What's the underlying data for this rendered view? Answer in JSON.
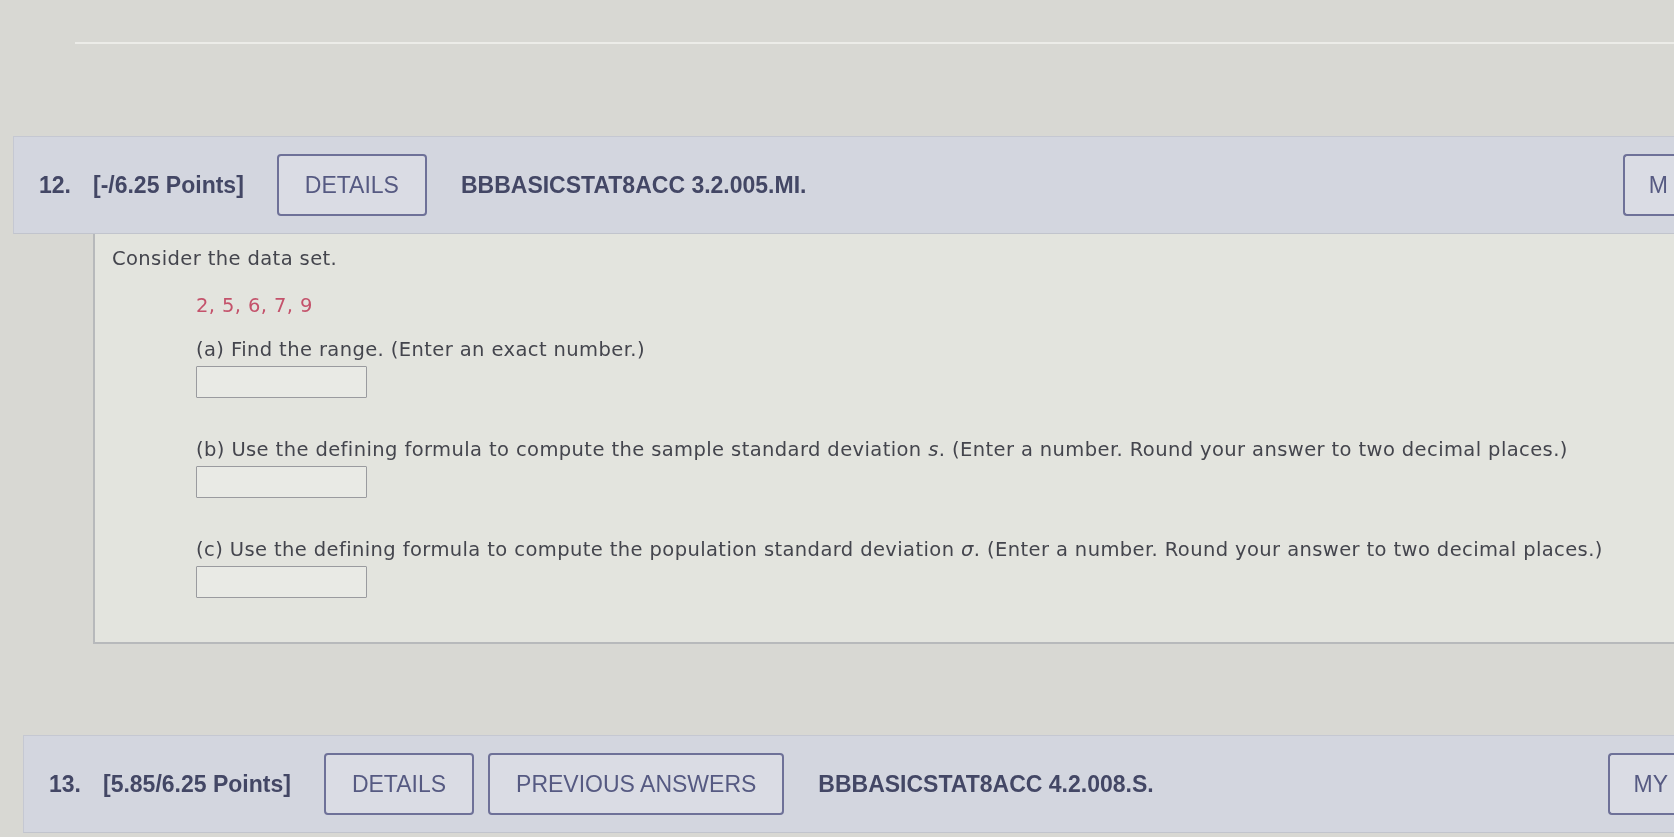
{
  "questions": [
    {
      "number": "12.",
      "points": "[-/6.25 Points]",
      "buttons": [
        {
          "label": "DETAILS"
        }
      ],
      "code": "BBBASICSTAT8ACC 3.2.005.MI.",
      "corner_button": "M",
      "body": {
        "intro": "Consider the data set.",
        "data": "2, 5, 6, 7, 9",
        "parts": [
          {
            "prompt": "(a) Find the range. (Enter an exact number.)"
          },
          {
            "prompt": "(b) Use the defining formula to compute the sample standard deviation *s*. (Enter a number. Round your answer to two decimal places.)"
          },
          {
            "prompt": "(c) Use the defining formula to compute the population standard deviation *σ*. (Enter a number. Round your answer to two decimal places.)"
          }
        ]
      }
    },
    {
      "number": "13.",
      "points": "[5.85/6.25 Points]",
      "buttons": [
        {
          "label": "DETAILS"
        },
        {
          "label": "PREVIOUS ANSWERS"
        }
      ],
      "code": "BBBASICSTAT8ACC 4.2.008.S.",
      "corner_button": "MY"
    }
  ]
}
